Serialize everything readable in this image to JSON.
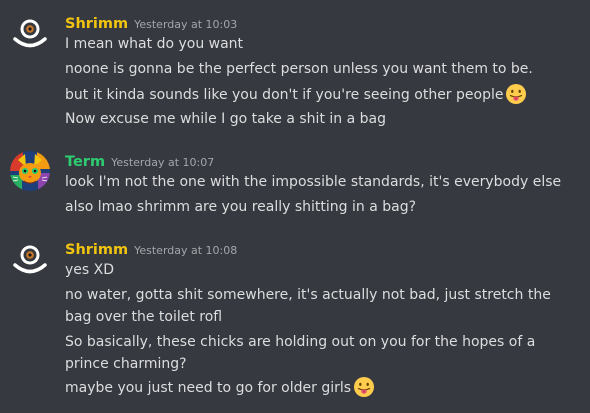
{
  "colors": {
    "background": "#36393f",
    "shrimm_name": "#f1c40f",
    "term_name": "#2ecc71",
    "message_text": "#dcddde",
    "timestamp": "#a3a6aa"
  },
  "groups": [
    {
      "username": "Shrimm",
      "timestamp": "Yesterday at 10:03",
      "avatar_icon": "shrimm-eye-avatar-icon",
      "messages": [
        {
          "text": "I mean what do you want",
          "emoji": null
        },
        {
          "text": "noone is gonna be the perfect person unless you want them to be.",
          "emoji": null
        },
        {
          "text": "but it kinda sounds like you don't if you're seeing other people",
          "emoji": "tongue-face-emoji"
        },
        {
          "text": "Now excuse me while I go take a shit in a bag",
          "emoji": null
        }
      ]
    },
    {
      "username": "Term",
      "timestamp": "Yesterday at 10:07",
      "avatar_icon": "colorful-cat-avatar-icon",
      "messages": [
        {
          "text": "look I'm not the one with the impossible standards, it's everybody else",
          "emoji": null
        },
        {
          "text": "also lmao shrimm are you really shitting in a bag?",
          "emoji": null
        }
      ]
    },
    {
      "username": "Shrimm",
      "timestamp": "Yesterday at 10:08",
      "avatar_icon": "shrimm-eye-avatar-icon",
      "messages": [
        {
          "text": "yes XD",
          "emoji": null
        },
        {
          "text": "no water, gotta shit somewhere, it's actually not bad, just stretch the bag over the toilet rofl",
          "emoji": null
        },
        {
          "text": "So basically, these chicks are holding out on you for the hopes of a prince charming?",
          "emoji": null
        },
        {
          "text": "maybe you just need to go for older girls",
          "emoji": "tongue-face-emoji"
        }
      ]
    }
  ]
}
